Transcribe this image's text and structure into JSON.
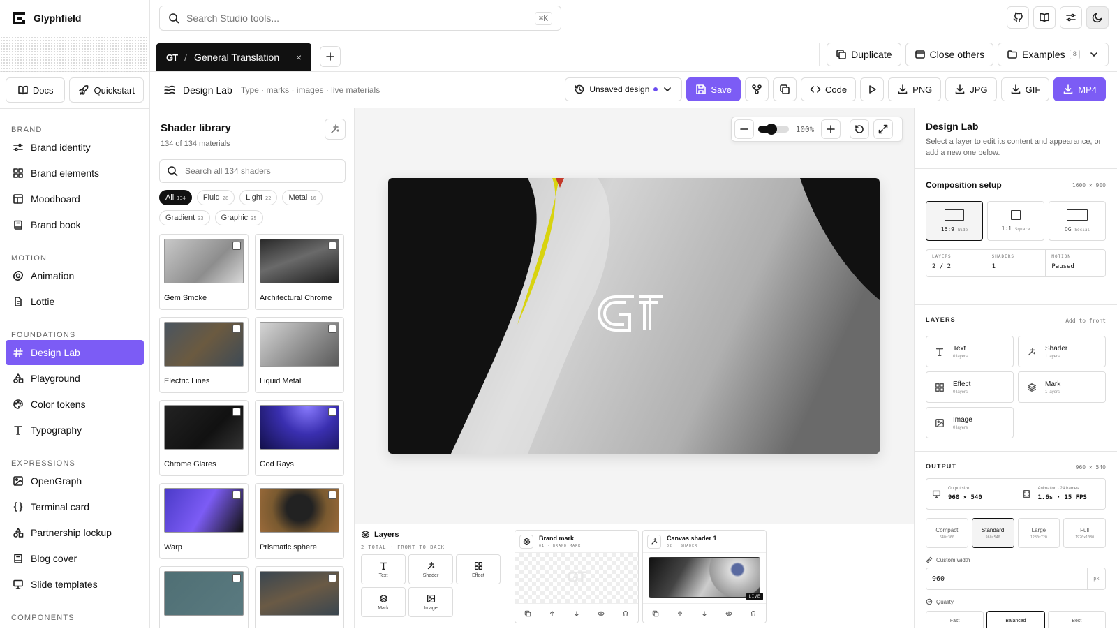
{
  "app": {
    "name": "Glyphfield"
  },
  "search": {
    "placeholder": "Search Studio tools...",
    "shortcut": "⌘K"
  },
  "top_icons": [
    "github-icon",
    "book-icon",
    "settings-sliders-icon",
    "moon-icon"
  ],
  "tab": {
    "logo": "GT",
    "separator": "/",
    "title": "General Translation",
    "close": "×"
  },
  "tab_actions": {
    "duplicate": "Duplicate",
    "close_others": "Close others",
    "examples": "Examples",
    "examples_count": "8"
  },
  "sidebar": {
    "docs": "Docs",
    "quickstart": "Quickstart",
    "sections": [
      {
        "title": "BRAND",
        "items": [
          {
            "label": "Brand identity",
            "icon": "sliders-icon"
          },
          {
            "label": "Brand elements",
            "icon": "grid-icon"
          },
          {
            "label": "Moodboard",
            "icon": "layout-icon"
          },
          {
            "label": "Brand book",
            "icon": "book-icon"
          }
        ]
      },
      {
        "title": "MOTION",
        "items": [
          {
            "label": "Animation",
            "icon": "orbit-icon"
          },
          {
            "label": "Lottie",
            "icon": "file-icon"
          }
        ]
      },
      {
        "title": "FOUNDATIONS",
        "items": [
          {
            "label": "Design Lab",
            "icon": "hash-icon",
            "active": true
          },
          {
            "label": "Playground",
            "icon": "shapes-icon"
          },
          {
            "label": "Color tokens",
            "icon": "palette-icon"
          },
          {
            "label": "Typography",
            "icon": "type-icon"
          }
        ]
      },
      {
        "title": "EXPRESSIONS",
        "items": [
          {
            "label": "OpenGraph",
            "icon": "image-icon"
          },
          {
            "label": "Terminal card",
            "icon": "braces-icon"
          },
          {
            "label": "Partnership lockup",
            "icon": "shapes-icon"
          },
          {
            "label": "Blog cover",
            "icon": "book-icon"
          },
          {
            "label": "Slide templates",
            "icon": "presentation-icon"
          }
        ]
      },
      {
        "title": "COMPONENTS",
        "items": []
      }
    ]
  },
  "actionbar": {
    "title": "Design Lab",
    "crumbs": "Type · marks · images · live materials",
    "unsaved": "Unsaved design",
    "save": "Save",
    "code": "Code",
    "png": "PNG",
    "jpg": "JPG",
    "gif": "GIF",
    "mp4": "MP4"
  },
  "library": {
    "title": "Shader library",
    "subtitle": "134 of 134 materials",
    "search_placeholder": "Search all 134 shaders",
    "chips": [
      {
        "label": "All",
        "count": "134",
        "active": true
      },
      {
        "label": "Fluid",
        "count": "28"
      },
      {
        "label": "Light",
        "count": "22"
      },
      {
        "label": "Metal",
        "count": "16"
      },
      {
        "label": "Gradient",
        "count": "33"
      },
      {
        "label": "Graphic",
        "count": "35"
      }
    ],
    "cards": [
      {
        "name": "Gem Smoke",
        "bg": "linear-gradient(135deg,#c8c8c8,#8d8d8d 60%,#d8d8d8)"
      },
      {
        "name": "Architectural Chrome",
        "bg": "linear-gradient(160deg,#2a2a2a,#6a6a6a 45%,#1e1e1e)"
      },
      {
        "name": "Electric Lines",
        "bg": "linear-gradient(135deg,#4a5560,#6b5a40 50%,#3e4a55)"
      },
      {
        "name": "Liquid Metal",
        "bg": "linear-gradient(135deg,#d5d5d5,#909090 55%,#5a5a5a)"
      },
      {
        "name": "Chrome Glares",
        "bg": "linear-gradient(135deg,#222,#111 60%,#333)"
      },
      {
        "name": "God Rays",
        "bg": "radial-gradient(circle at 60% 0,#8a7cff,#3a2fb0 45%,#12104a)"
      },
      {
        "name": "Warp",
        "bg": "linear-gradient(120deg,#4b3bc8,#7c5cf5 50%,#111)"
      },
      {
        "name": "Prismatic sphere",
        "bg": "radial-gradient(circle at 50% 45%,#222 28%,#7a5a30 60%,#9a6a3a)"
      },
      {
        "name": "",
        "bg": "linear-gradient(135deg,#4f6f74,#5a7a80)"
      },
      {
        "name": "",
        "bg": "linear-gradient(160deg,#3a4650,#6a5a45 50%,#3a4650)"
      }
    ]
  },
  "canvas": {
    "zoom": "100%",
    "zoom_level": 0.3,
    "mark": "GT",
    "colors": {
      "bg": "#111111",
      "shape": "#b5b5b5",
      "streak": "#d8d30f",
      "accent": "#c43a2a"
    }
  },
  "layers_panel": {
    "title": "Layers",
    "subtitle": "2 TOTAL · FRONT TO BACK",
    "add": [
      {
        "label": "Text",
        "icon": "text-icon"
      },
      {
        "label": "Shader",
        "icon": "sparkle-icon"
      },
      {
        "label": "Effect",
        "icon": "grid-icon"
      },
      {
        "label": "Mark",
        "icon": "layers-icon"
      },
      {
        "label": "Image",
        "icon": "image-icon"
      }
    ],
    "items": [
      {
        "name": "Brand mark",
        "sub": "01 · BRAND MARK"
      },
      {
        "name": "Canvas shader 1",
        "sub": "02 · SHADER",
        "badge": "LIVE"
      }
    ]
  },
  "inspector": {
    "title": "Design Lab",
    "description": "Select a layer to edit its content and appearance, or add a new one below.",
    "composition": {
      "title": "Composition setup",
      "size": "1600 × 900",
      "ratios": [
        {
          "label": "16:9",
          "sub": "Wide",
          "active": true
        },
        {
          "label": "1:1",
          "sub": "Square"
        },
        {
          "label": "OG",
          "sub": "Social"
        }
      ],
      "stats": [
        {
          "key": "LAYERS",
          "value": "2 / 2"
        },
        {
          "key": "SHADERS",
          "value": "1"
        },
        {
          "key": "MOTION",
          "value": "Paused"
        }
      ]
    },
    "layers": {
      "title": "LAYERS",
      "hint": "Add to front",
      "types": [
        {
          "label": "Text",
          "count": "0 layers",
          "icon": "text-icon"
        },
        {
          "label": "Shader",
          "count": "1 layers",
          "icon": "sparkle-icon"
        },
        {
          "label": "Effect",
          "count": "0 layers",
          "icon": "grid-icon"
        },
        {
          "label": "Mark",
          "count": "1 layers",
          "icon": "layers-icon"
        },
        {
          "label": "Image",
          "count": "0 layers",
          "icon": "image-icon"
        }
      ]
    },
    "output": {
      "title": "OUTPUT",
      "size_tag": "960 × 540",
      "output_size_label": "Output size",
      "output_size": "960 × 540",
      "animation_label": "Animation · 24 frames",
      "animation": "1.6s · 15 FPS",
      "presets": [
        {
          "label": "Compact",
          "size": "640×360"
        },
        {
          "label": "Standard",
          "size": "960×540",
          "active": true
        },
        {
          "label": "Large",
          "size": "1280×720"
        },
        {
          "label": "Full",
          "size": "1920×1080"
        }
      ],
      "custom_width_label": "Custom width",
      "custom_width": "960",
      "unit": "px",
      "quality_label": "Quality",
      "quality": [
        {
          "label": "Fast"
        },
        {
          "label": "Balanced",
          "active": true
        },
        {
          "label": "Best"
        }
      ]
    }
  }
}
